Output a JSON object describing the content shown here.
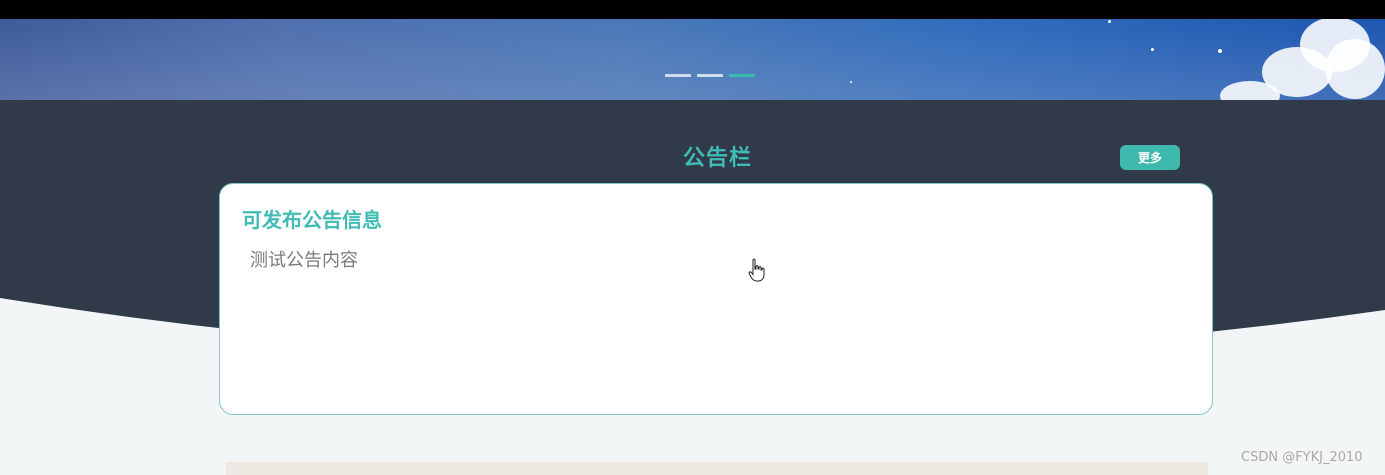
{
  "banner": {
    "carousel_count": 3,
    "active_index": 2
  },
  "notice_section": {
    "title": "公告栏",
    "more_label": "更多",
    "card": {
      "title": "可发布公告信息",
      "content": "测试公告内容"
    }
  },
  "watermark": "CSDN @FYKJ_2010",
  "colors": {
    "accent": "#3fbcb4",
    "dark_band": "#313a48",
    "page_bg": "#f2f6f7",
    "card_border": "#7fc8c7"
  }
}
